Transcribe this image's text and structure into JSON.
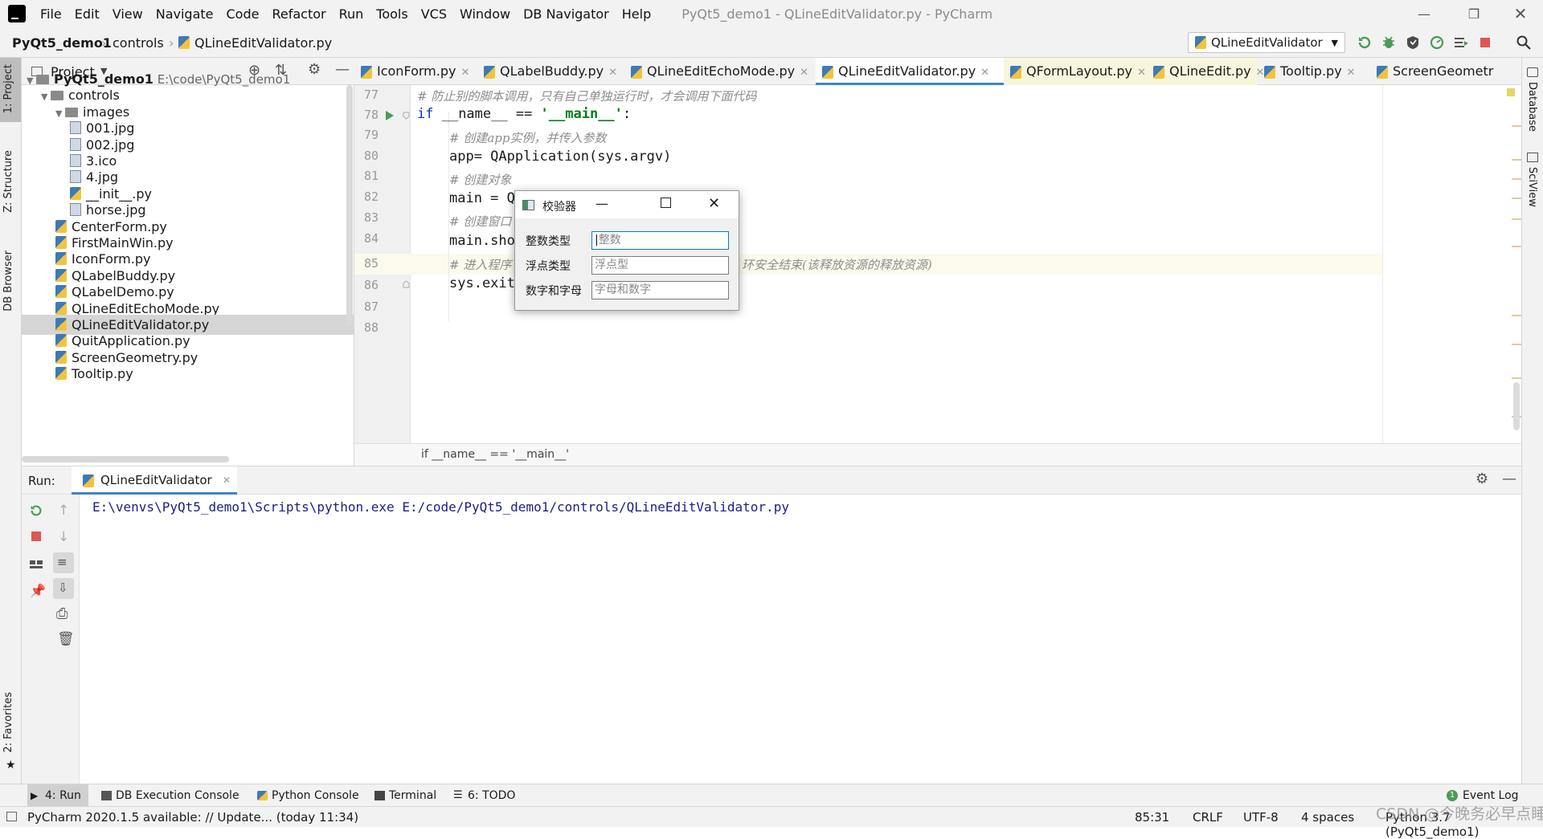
{
  "menubar": {
    "items": [
      "File",
      "Edit",
      "View",
      "Navigate",
      "Code",
      "Refactor",
      "Run",
      "Tools",
      "VCS",
      "Window",
      "DB Navigator",
      "Help"
    ],
    "window_title": "PyQt5_demo1 - QLineEditValidator.py - PyCharm"
  },
  "navbar": {
    "crumbs": [
      "PyQt5_demo1",
      "controls",
      "QLineEditValidator.py"
    ],
    "run_config": "QLineEditValidator"
  },
  "left_stripe": {
    "project": "1: Project",
    "structure": "Z: Structure",
    "db_browser": "DB Browser",
    "favorites": "2: Favorites"
  },
  "right_stripe": {
    "database": "Database",
    "sciview": "SciView"
  },
  "project": {
    "header": "Project",
    "tree": [
      {
        "label": "PyQt5_demo1",
        "hint": "E:\\code\\PyQt5_demo1",
        "type": "root"
      },
      {
        "label": "controls",
        "type": "folder"
      },
      {
        "label": "images",
        "type": "folder"
      },
      {
        "label": "001.jpg",
        "type": "img"
      },
      {
        "label": "002.jpg",
        "type": "img"
      },
      {
        "label": "3.ico",
        "type": "img"
      },
      {
        "label": "4.jpg",
        "type": "img"
      },
      {
        "label": "__init__.py",
        "type": "py"
      },
      {
        "label": "horse.jpg",
        "type": "img"
      },
      {
        "label": "CenterForm.py",
        "type": "py"
      },
      {
        "label": "FirstMainWin.py",
        "type": "py"
      },
      {
        "label": "IconForm.py",
        "type": "py"
      },
      {
        "label": "QLabelBuddy.py",
        "type": "py"
      },
      {
        "label": "QLabelDemo.py",
        "type": "py"
      },
      {
        "label": "QLineEditEchoMode.py",
        "type": "py"
      },
      {
        "label": "QLineEditValidator.py",
        "type": "py",
        "selected": true
      },
      {
        "label": "QuitApplication.py",
        "type": "py"
      },
      {
        "label": "ScreenGeometry.py",
        "type": "py"
      },
      {
        "label": "Tooltip.py",
        "type": "py"
      }
    ]
  },
  "editor_tabs": [
    "IconForm.py",
    "QLabelBuddy.py",
    "QLineEditEchoMode.py",
    "QLineEditValidator.py",
    "QFormLayout.py",
    "QLineEdit.py",
    "Tooltip.py",
    "ScreenGeometr"
  ],
  "active_tab": "QLineEditValidator.py",
  "editor": {
    "line_numbers": [
      "77",
      "78",
      "79",
      "80",
      "81",
      "82",
      "83",
      "84",
      "85",
      "86",
      "87",
      "88"
    ],
    "lines": {
      "l77": "# 防止别的脚本调用，只有自己单独运行时，才会调用下面代码",
      "l78_kw": "if",
      "l78_a": " __name__ == ",
      "l78_str": "'__main__'",
      "l78_b": ":",
      "l79": "# 创建app实例，并传入参数",
      "l80": "app= QApplication(sys.argv)",
      "l81": "# 创建对象",
      "l82": "main = Q",
      "l83": "# 创建窗口",
      "l84": "main.sho",
      "l85a": "# 进入程序",
      "l85b": "环安全结束(该释放资源的释放资源)",
      "l86": "sys.exit"
    },
    "breadcrumb": "if __name__ == '__main__'"
  },
  "run_panel": {
    "label": "Run:",
    "tab": "QLineEditValidator",
    "output": "E:\\venvs\\PyQt5_demo1\\Scripts\\python.exe E:/code/PyQt5_demo1/controls/QLineEditValidator.py"
  },
  "dialog": {
    "title": "校验器",
    "rows": [
      {
        "label": "整数类型",
        "placeholder": "整数"
      },
      {
        "label": "浮点类型",
        "placeholder": "浮点型"
      },
      {
        "label": "数字和字母",
        "placeholder": "字母和数字"
      }
    ]
  },
  "bottom_tabs": [
    "4: Run",
    "DB Execution Console",
    "Python Console",
    "Terminal",
    "6: TODO"
  ],
  "event_log": {
    "count": "1",
    "label": "Event Log"
  },
  "status": {
    "message": "PyCharm 2020.1.5 available: // Update... (today 11:34)",
    "position": "85:31",
    "line_sep": "CRLF",
    "encoding": "UTF-8",
    "indent": "4 spaces",
    "interpreter": "Python 3.7 (PyQt5_demo1)",
    "watermark": "CSDN @今晚务必早点睡"
  },
  "colors": {
    "accent": "#4083c9",
    "keyword": "#0033b3",
    "string": "#067d17",
    "comment": "#8c8c8c",
    "run_green": "#499c54",
    "stop_red": "#e05555"
  }
}
